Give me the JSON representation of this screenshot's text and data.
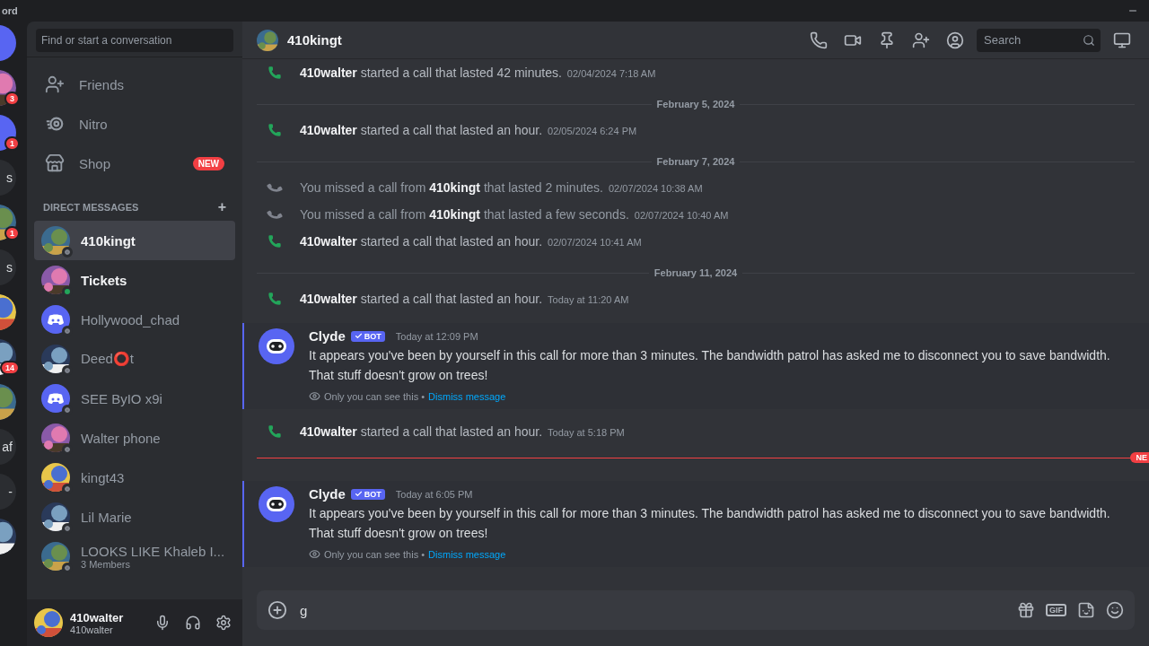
{
  "window": {
    "title": "ord"
  },
  "rail": [
    {
      "kind": "discord"
    },
    {
      "kind": "picture",
      "badge": "3"
    },
    {
      "kind": "discord",
      "badge": "1"
    },
    {
      "kind": "initials",
      "text": "s"
    },
    {
      "kind": "picture",
      "badge": "1"
    },
    {
      "kind": "initials",
      "text": "s"
    },
    {
      "kind": "picture"
    },
    {
      "kind": "picture",
      "badge": "14"
    },
    {
      "kind": "picture"
    },
    {
      "kind": "initials",
      "text": "af"
    },
    {
      "kind": "initials",
      "text": "-"
    },
    {
      "kind": "picture"
    }
  ],
  "sidebar": {
    "search": {
      "placeholder": "Find or start a conversation"
    },
    "nav": [
      {
        "kind": "friends",
        "label": "Friends"
      },
      {
        "kind": "nitro",
        "label": "Nitro"
      },
      {
        "kind": "shop",
        "label": "Shop",
        "badge": "NEW"
      }
    ],
    "section": "DIRECT MESSAGES",
    "add": "+",
    "dms": [
      {
        "name": "410kingt",
        "selected": true,
        "online": false,
        "unread": false,
        "kind": "picture"
      },
      {
        "name": "Tickets",
        "selected": false,
        "online": true,
        "unread": true,
        "kind": "picture"
      },
      {
        "name": "Hollywood_chad",
        "selected": false,
        "online": false,
        "unread": false,
        "kind": "discord"
      },
      {
        "name": "Deed⭕t",
        "selected": false,
        "online": false,
        "unread": false,
        "kind": "picture"
      },
      {
        "name": "SEE ByIO x9i",
        "selected": false,
        "online": false,
        "unread": false,
        "kind": "discord"
      },
      {
        "name": "Walter phone",
        "selected": false,
        "online": false,
        "unread": false,
        "kind": "picture"
      },
      {
        "name": "kingt43",
        "selected": false,
        "online": false,
        "unread": false,
        "kind": "picture"
      },
      {
        "name": "Lil Marie",
        "selected": false,
        "online": false,
        "unread": false,
        "kind": "picture"
      },
      {
        "name": "LOOKS LIKE Khaleb I...",
        "subtitle": "3 Members",
        "selected": false,
        "online": false,
        "unread": false,
        "kind": "picture"
      }
    ],
    "user": {
      "name": "410walter",
      "tag": "410walter"
    }
  },
  "header": {
    "name": "410kingt",
    "search": {
      "placeholder": "Search"
    }
  },
  "messages": [
    {
      "kind": "call",
      "text": "**410walter** started a call that lasted 42 minutes.",
      "time": "02/04/2024 7:18 AM"
    },
    {
      "kind": "date",
      "text": "February 5, 2024"
    },
    {
      "kind": "call",
      "text": "**410walter** started a call that lasted an hour.",
      "time": "02/05/2024 6:24 PM"
    },
    {
      "kind": "date",
      "text": "February 7, 2024"
    },
    {
      "kind": "missed",
      "text": "You missed a call from **410kingt** that lasted 2 minutes.",
      "time": "02/07/2024 10:38 AM"
    },
    {
      "kind": "missed",
      "text": "You missed a call from **410kingt** that lasted a few seconds.",
      "time": "02/07/2024 10:40 AM"
    },
    {
      "kind": "call",
      "text": "**410walter** started a call that lasted an hour.",
      "time": "02/07/2024 10:41 AM"
    },
    {
      "kind": "date",
      "text": "February 11, 2024"
    },
    {
      "kind": "call",
      "text": "**410walter** started a call that lasted an hour.",
      "time": "Today at 11:20 AM"
    },
    {
      "kind": "bot",
      "author": "Clyde",
      "tag": "BOT",
      "time": "Today at 12:09 PM",
      "text": "It appears you've been by yourself in this call for more than 3 minutes. The bandwidth patrol has asked me to disconnect you to save bandwidth. That stuff doesn't grow on trees!",
      "note": "Only you can see this •",
      "link": "Dismiss message"
    },
    {
      "kind": "call",
      "text": "**410walter** started a call that lasted an hour.",
      "time": "Today at 5:18 PM"
    },
    {
      "kind": "new",
      "text": "NE"
    },
    {
      "kind": "bot",
      "author": "Clyde",
      "tag": "BOT",
      "time": "Today at 6:05 PM",
      "text": "It appears you've been by yourself in this call for more than 3 minutes. The bandwidth patrol has asked me to disconnect you to save bandwidth. That stuff doesn't grow on trees!",
      "note": "Only you can see this •",
      "link": "Dismiss message"
    }
  ],
  "composer": {
    "value": "g",
    "gif": "GIF"
  }
}
